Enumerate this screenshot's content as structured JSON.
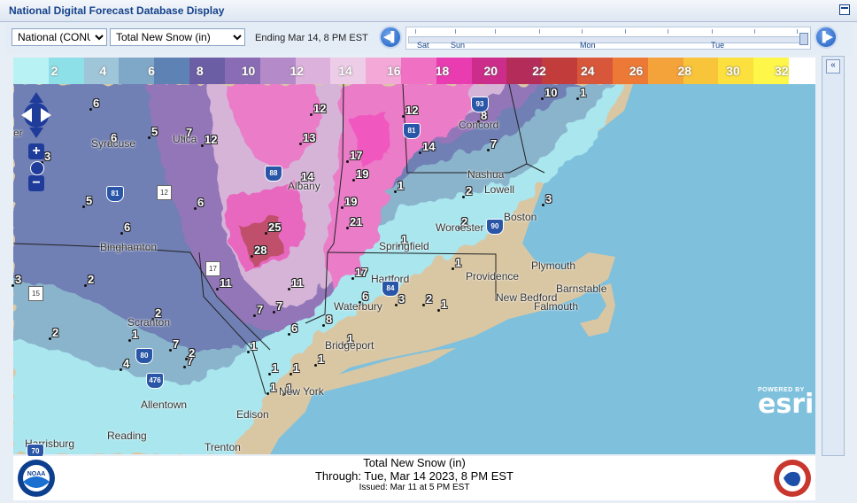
{
  "title": "National Digital Forecast Database Display",
  "toolbar": {
    "region_select": "National (CONUS)",
    "element_select": "Total New Snow (in)",
    "ending_label": "Ending Mar 14,   8 PM EST",
    "prev_icon": "step-back-icon",
    "next_icon": "step-forward-icon"
  },
  "timeline": {
    "days": [
      "Sat",
      "Sun",
      "Mon",
      "Tue"
    ],
    "position": 1.0
  },
  "legend": {
    "labels": [
      "2",
      "4",
      "6",
      "8",
      "10",
      "12",
      "14",
      "16",
      "18",
      "20",
      "22",
      "24",
      "26",
      "28",
      "30",
      "32"
    ],
    "colors": [
      "#b9f2f5",
      "#8ee0e8",
      "#9ec6d8",
      "#7fa8c8",
      "#5f82b4",
      "#6b5ea4",
      "#8a6cb4",
      "#b48ac8",
      "#dcb2dc",
      "#eccce6",
      "#f4a8d8",
      "#f070c4",
      "#e83cb0",
      "#cc2d8a",
      "#b42d5a",
      "#c23c3c",
      "#d8563a",
      "#ec7a36",
      "#f4a23a",
      "#f8c43a",
      "#fce03e",
      "#fff64a",
      "#ffffff"
    ]
  },
  "map_labels": {
    "values": [
      {
        "v": "6"
      },
      {
        "v": "5"
      },
      {
        "v": "6"
      },
      {
        "v": "7"
      },
      {
        "v": "12"
      },
      {
        "v": "3"
      },
      {
        "v": "12"
      },
      {
        "v": "13"
      },
      {
        "v": "14"
      },
      {
        "v": "12"
      },
      {
        "v": "8"
      },
      {
        "v": "17"
      },
      {
        "v": "14"
      },
      {
        "v": "7"
      },
      {
        "v": "19"
      },
      {
        "v": "1"
      },
      {
        "v": "19"
      },
      {
        "v": "2"
      },
      {
        "v": "5"
      },
      {
        "v": "6"
      },
      {
        "v": "21"
      },
      {
        "v": "2"
      },
      {
        "v": "3"
      },
      {
        "v": "6"
      },
      {
        "v": "25"
      },
      {
        "v": "28"
      },
      {
        "v": "1"
      },
      {
        "v": "1"
      },
      {
        "v": "17"
      },
      {
        "v": "3"
      },
      {
        "v": "2"
      },
      {
        "v": "11"
      },
      {
        "v": "11"
      },
      {
        "v": "6"
      },
      {
        "v": "3"
      },
      {
        "v": "2"
      },
      {
        "v": "1"
      },
      {
        "v": "7"
      },
      {
        "v": "7"
      },
      {
        "v": "8"
      },
      {
        "v": "6"
      },
      {
        "v": "2"
      },
      {
        "v": "1"
      },
      {
        "v": "7"
      },
      {
        "v": "1"
      },
      {
        "v": "1"
      },
      {
        "v": "1"
      },
      {
        "v": "7"
      },
      {
        "v": "4"
      },
      {
        "v": "2"
      },
      {
        "v": "1"
      },
      {
        "v": "1"
      },
      {
        "v": "1"
      },
      {
        "v": "1"
      },
      {
        "v": "10"
      },
      {
        "v": "1"
      },
      {
        "v": "2"
      }
    ],
    "cities": [
      "Syracuse",
      "Utica",
      "Albany",
      "Binghamton",
      "Springfield",
      "Worcester",
      "Boston",
      "Concord",
      "Nashua",
      "Lowell",
      "Hartford",
      "Providence",
      "Plymouth",
      "New Bedford",
      "Falmouth",
      "Barnstable",
      "Waterbury",
      "Bridgeport",
      "Scranton",
      "Allentown",
      "New York",
      "Edison",
      "Reading",
      "Trenton",
      "Harrisburg",
      "er"
    ],
    "highways": [
      "93",
      "81",
      "90",
      "88",
      "81",
      "12",
      "17",
      "84",
      "15",
      "80",
      "476",
      "70"
    ]
  },
  "attribution": {
    "powered_by": "POWERED BY",
    "esri": "esri"
  },
  "footer": {
    "line1": "Total New Snow (in)",
    "line2": "Through: Tue, Mar 14 2023,   8 PM EST",
    "line3": "Issued: Mar 11 at 5 PM EST",
    "left_logo": "noaa-logo",
    "right_logo": "nws-logo"
  }
}
